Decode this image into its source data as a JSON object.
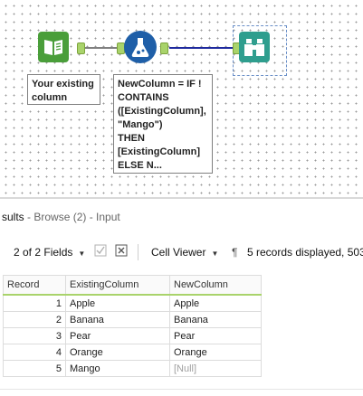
{
  "canvas": {
    "annotation_input": "Your existing column",
    "annotation_formula": "NewColumn = IF !\nCONTAINS\n([ExistingColumn],\n\"Mango\")\nTHEN\n[ExistingColumn]\nELSE N..."
  },
  "results": {
    "title": "sults",
    "subtitle": " - Browse (2) - Input"
  },
  "toolbar": {
    "fields": "2 of 2 Fields",
    "cell_viewer": "Cell Viewer",
    "pilcrow": "¶",
    "records": "5 records displayed, 503"
  },
  "table": {
    "headers": [
      "Record",
      "ExistingColumn",
      "NewColumn"
    ],
    "rows": [
      [
        "1",
        "Apple",
        "Apple"
      ],
      [
        "2",
        "Banana",
        "Banana"
      ],
      [
        "3",
        "Pear",
        "Pear"
      ],
      [
        "4",
        "Orange",
        "Orange"
      ],
      [
        "5",
        "Mango",
        "[Null]"
      ]
    ]
  },
  "colors": {
    "input_tool": "#4a9e3a",
    "formula_tool": "#1f5fa8",
    "browse_tool": "#2f9e8e",
    "connection": "#1f2a9e",
    "anchor": "#a9d36b"
  }
}
